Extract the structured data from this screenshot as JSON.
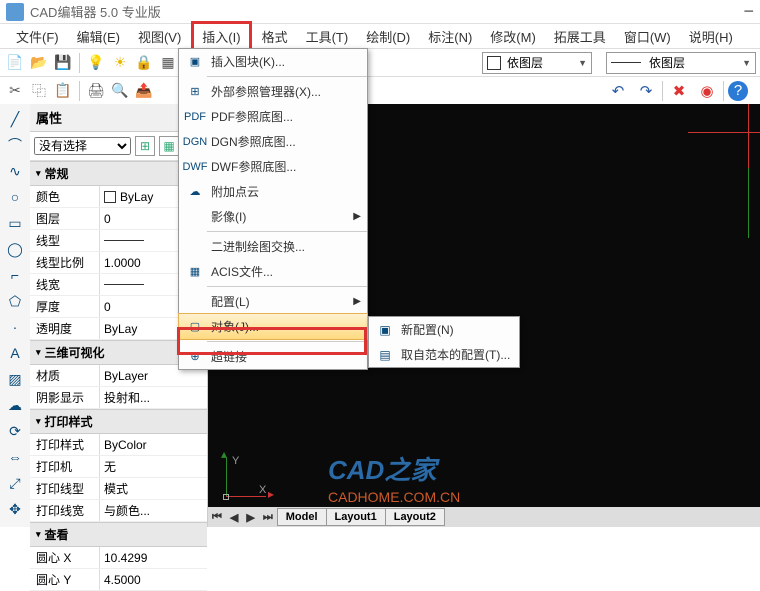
{
  "app": {
    "title": "CAD编辑器 5.0 专业版"
  },
  "menu": {
    "file": "文件(F)",
    "edit": "编辑(E)",
    "view": "视图(V)",
    "insert": "插入(I)",
    "format": "格式",
    "tools": "工具(T)",
    "draw": "绘制(D)",
    "annotate": "标注(N)",
    "modify": "修改(M)",
    "extend": "拓展工具",
    "window": "窗口(W)",
    "help": "说明(H)"
  },
  "dropdown": {
    "insert_block": "插入图块(K)...",
    "xref_mgr": "外部参照管理器(X)...",
    "pdf_underlay": "PDF参照底图...",
    "dgn_underlay": "DGN参照底图...",
    "dwf_underlay": "DWF参照底图...",
    "point_cloud": "附加点云",
    "image": "影像(I)",
    "binary_dwg": "二进制绘图交换...",
    "acis": "ACIS文件...",
    "config": "配置(L)",
    "object": "对象(J)...",
    "hyperlink": "超链接"
  },
  "submenu": {
    "new_config": "新配置(N)",
    "from_template": "取自范本的配置(T)..."
  },
  "layer": {
    "label": "依图层"
  },
  "properties": {
    "title": "属性",
    "no_selection": "没有选择",
    "cat_general": "常规",
    "color_k": "颜色",
    "color_v": "ByLay",
    "layer_k": "图层",
    "layer_v": "0",
    "linetype_k": "线型",
    "ltscale_k": "线型比例",
    "ltscale_v": "1.0000",
    "lineweight_k": "线宽",
    "thickness_k": "厚度",
    "thickness_v": "0",
    "transparency_k": "透明度",
    "transparency_v": "ByLay",
    "cat_3dviz": "三维可视化",
    "material_k": "材质",
    "material_v": "ByLayer",
    "shadow_k": "阴影显示",
    "shadow_v": "投射和...",
    "cat_plot": "打印样式",
    "plotstyle_k": "打印样式",
    "plotstyle_v": "ByColor",
    "plotter_k": "打印机",
    "plotter_v": "无",
    "plotlt_k": "打印线型",
    "plotlt_v": "模式",
    "plotlw_k": "打印线宽",
    "plotlw_v": "与颜色...",
    "cat_view": "查看",
    "cx_k": "圆心 X",
    "cx_v": "10.4299",
    "cy_k": "圆心 Y",
    "cy_v": "4.5000"
  },
  "canvas": {
    "watermark": "CAD之家",
    "watermark_url": "CADHOME.COM.CN",
    "tab_model": "Model",
    "tab_layout1": "Layout1",
    "tab_layout2": "Layout2",
    "y_label": "Y",
    "x_label": "X"
  }
}
